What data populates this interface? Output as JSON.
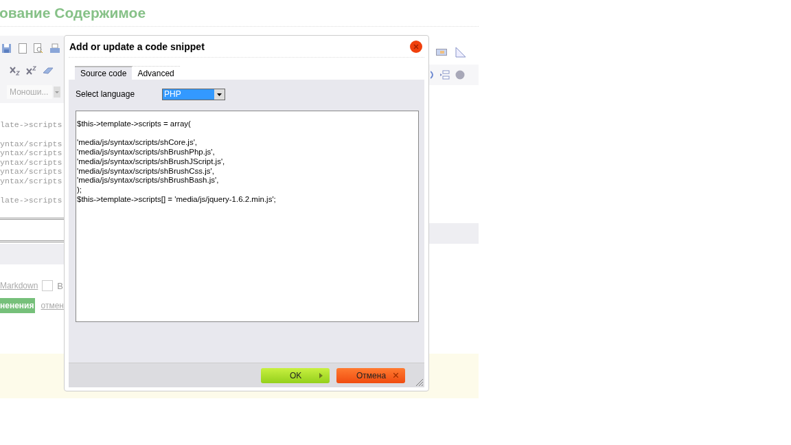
{
  "page": {
    "title": "ование Содержимое",
    "font_select": "Моноши...",
    "code_blocks": [
      [
        "late->scripts"
      ],
      [
        "yntax/scripts",
        "yntax/scripts",
        "yntax/scripts",
        "yntax/scripts",
        "yntax/scripts"
      ],
      [
        "late->scripts"
      ]
    ],
    "markdown_link": "Markdown",
    "checkbox": {
      "checked": false,
      "label": "В"
    },
    "save_button": "ненения",
    "cancel_link": "отмен"
  },
  "dialog": {
    "title": "Add or update a code snippet",
    "tabs": [
      {
        "label": "Source code",
        "selected": true
      },
      {
        "label": "Advanced",
        "selected": false
      }
    ],
    "language_label": "Select language",
    "language": "PHP",
    "code": "$this->template->scripts = array(\n\n'media/js/syntax/scripts/shCore.js',\n'media/js/syntax/scripts/shBrushPhp.js',\n'media/js/syntax/scripts/shBrushJScript.js',\n'media/js/syntax/scripts/shBrushCss.js',\n'media/js/syntax/scripts/shBrushBash.js',\n);\n$this->template->scripts[] = 'media/js/jquery-1.6.2.min.js';",
    "buttons": [
      {
        "kind": "ok",
        "label": "OK"
      },
      {
        "kind": "cancel",
        "label": "Отмена"
      }
    ]
  }
}
